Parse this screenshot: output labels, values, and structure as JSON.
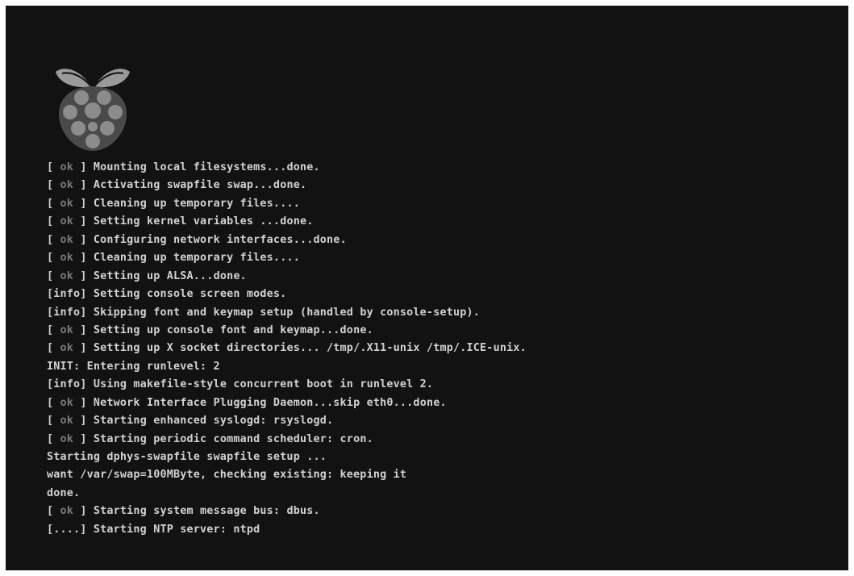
{
  "screen": {
    "background": "#121212",
    "text_color": "#d2d2d2",
    "status_dim_color": "#7a7a7a"
  },
  "logo": {
    "icon": "raspberry-pi-icon"
  },
  "console": {
    "lines": [
      {
        "status": "ok",
        "text": "Mounting local filesystems...done."
      },
      {
        "status": "ok",
        "text": "Activating swapfile swap...done."
      },
      {
        "status": "ok",
        "text": "Cleaning up temporary files...."
      },
      {
        "status": "ok",
        "text": "Setting kernel variables ...done."
      },
      {
        "status": "ok",
        "text": "Configuring network interfaces...done."
      },
      {
        "status": "ok",
        "text": "Cleaning up temporary files...."
      },
      {
        "status": "ok",
        "text": "Setting up ALSA...done."
      },
      {
        "status": "info",
        "text": "Setting console screen modes."
      },
      {
        "status": "info",
        "text": "Skipping font and keymap setup (handled by console-setup)."
      },
      {
        "status": "ok",
        "text": "Setting up console font and keymap...done."
      },
      {
        "status": "ok",
        "text": "Setting up X socket directories... /tmp/.X11-unix /tmp/.ICE-unix."
      },
      {
        "status": "",
        "text": "INIT: Entering runlevel: 2"
      },
      {
        "status": "info",
        "text": "Using makefile-style concurrent boot in runlevel 2."
      },
      {
        "status": "ok",
        "text": "Network Interface Plugging Daemon...skip eth0...done."
      },
      {
        "status": "ok",
        "text": "Starting enhanced syslogd: rsyslogd."
      },
      {
        "status": "ok",
        "text": "Starting periodic command scheduler: cron."
      },
      {
        "status": "",
        "text": "Starting dphys-swapfile swapfile setup ..."
      },
      {
        "status": "",
        "text": "want /var/swap=100MByte, checking existing: keeping it"
      },
      {
        "status": "",
        "text": "done."
      },
      {
        "status": "ok",
        "text": "Starting system message bus: dbus."
      },
      {
        "status": "pending",
        "text": "Starting NTP server: ntpd"
      }
    ],
    "status_labels": {
      "ok": "[ ok ]",
      "info": "[info]",
      "pending": "[....]"
    }
  }
}
